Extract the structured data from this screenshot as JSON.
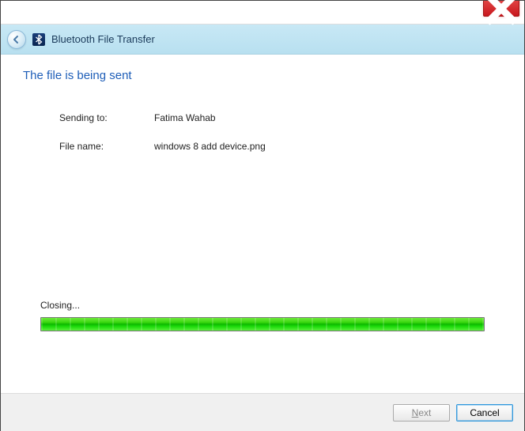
{
  "window": {
    "title": "Bluetooth File Transfer"
  },
  "heading": "The file is being sent",
  "info": {
    "sending_to_label": "Sending to:",
    "sending_to_value": "Fatima Wahab",
    "file_name_label": "File name:",
    "file_name_value": "windows 8 add device.png"
  },
  "progress": {
    "status_label": "Closing...",
    "percent": 100
  },
  "buttons": {
    "next": "Next",
    "cancel": "Cancel"
  }
}
